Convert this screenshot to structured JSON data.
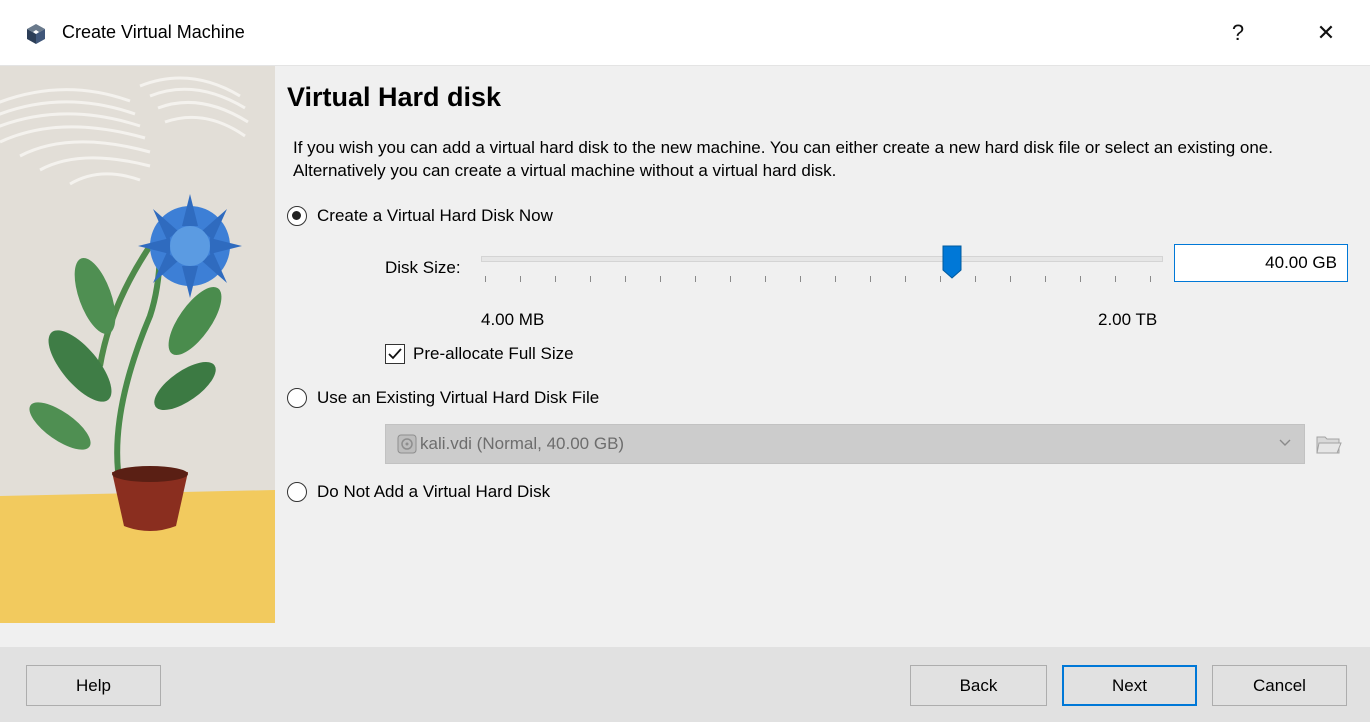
{
  "window": {
    "title": "Create Virtual Machine",
    "help_button": "?",
    "close_button": "✕"
  },
  "page": {
    "heading": "Virtual Hard disk",
    "description": "If you wish you can add a virtual hard disk to the new machine. You can either create a new hard disk file or select an existing one. Alternatively you can create a virtual machine without a virtual hard disk."
  },
  "options": {
    "create_new": {
      "label": "Create a Virtual Hard Disk Now",
      "selected": true
    },
    "use_existing": {
      "label": "Use an Existing Virtual Hard Disk File",
      "selected": false
    },
    "do_not_add": {
      "label": "Do Not Add a Virtual Hard Disk",
      "selected": false
    }
  },
  "disk_size": {
    "label": "Disk Size:",
    "value": "40.00 GB",
    "min_label": "4.00 MB",
    "max_label": "2.00 TB",
    "slider_fraction": 0.69
  },
  "preallocate": {
    "label": "Pre-allocate Full Size",
    "checked": true
  },
  "existing_disk": {
    "selected": "kali.vdi (Normal, 40.00 GB)",
    "disabled": true
  },
  "buttons": {
    "help": "Help",
    "back": "Back",
    "next": "Next",
    "cancel": "Cancel"
  },
  "colors": {
    "accent": "#0078d7",
    "window_bg": "#f0f0f0",
    "footer_bg": "#e1e1e1"
  },
  "icons": {
    "app": "virtualbox-cube-icon",
    "disk": "hard-disk-icon",
    "folder": "folder-open-icon",
    "dropdown": "chevron-down-icon"
  }
}
